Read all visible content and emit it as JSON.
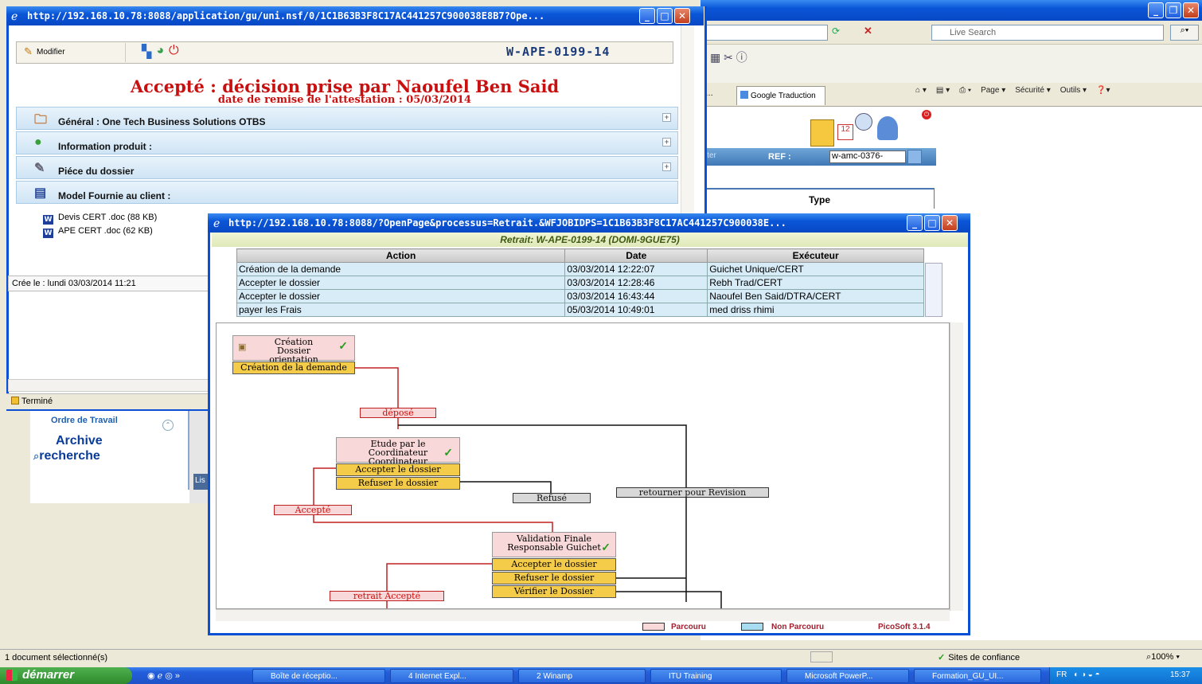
{
  "background_window": {
    "search_placeholder": "Live Search",
    "tab_google": "Google Traduction",
    "cmd_page": "Page ▾",
    "cmd_security": "Sécurité ▾",
    "cmd_tools": "Outils ▾",
    "ref_label": "REF :",
    "ref_value": "w-amc-0376-",
    "table_header_type": "Type",
    "ordre_de_travail": "Ordre de Travail",
    "archive": "Archive",
    "recherche": "recherche",
    "list_stub": "Lis",
    "iter_stub": "iter"
  },
  "doc_window": {
    "title": "http://192.168.10.78:8088/application/gu/uni.nsf/0/1C1B63B3F8C17AC441257C900038E8B7?Ope...",
    "modifier_label": "Modifier",
    "doc_number": "W-APE-0199-14",
    "status_title": "Accepté : décision prise par Naoufel Ben Said",
    "status_subtitle": "date de remise de l'attestation : 05/03/2014",
    "sections": [
      {
        "label": "Général : One Tech Business Solutions OTBS",
        "icon": "folder-gear-icon"
      },
      {
        "label": "Information produit :",
        "icon": "info-icon"
      },
      {
        "label": "Piéce du dossier",
        "icon": "paperclip-icon"
      },
      {
        "label": "Model Fournie au client :",
        "icon": "document-stack-icon"
      }
    ],
    "files": [
      {
        "name": "Devis CERT .doc (88 KB)"
      },
      {
        "name": "APE CERT .doc (62 KB)"
      }
    ],
    "created": "Crée le : lundi 03/03/2014 11:21",
    "status": "Terminé"
  },
  "workflow_window": {
    "title": "http://192.168.10.78:8088/?OpenPage&processus=Retrait.&WFJOBIDPS=1C1B63B3F8C17AC441257C900038E...",
    "header": "Retrait: W-APE-0199-14 (DOMI-9GUE75)",
    "columns": [
      "Action",
      "Date",
      "Exécuteur"
    ],
    "rows": [
      {
        "action": "Création de la demande",
        "date": "03/03/2014 12:22:07",
        "executor": "Guichet Unique/CERT"
      },
      {
        "action": "Accepter le dossier",
        "date": "03/03/2014 12:28:46",
        "executor": "Rebh Trad/CERT"
      },
      {
        "action": "Accepter le dossier",
        "date": "03/03/2014 16:43:44",
        "executor": "Naoufel Ben Said/DTRA/CERT"
      },
      {
        "action": "payer les Frais",
        "date": "05/03/2014 10:49:01",
        "executor": "med driss rhimi"
      }
    ],
    "diagram": {
      "node1_title": "Création Dossier orientation",
      "node1_btn": "Création de la demande",
      "label_depose": "déposé",
      "node2_title": "Etude par le Coordinateur Coordinateur",
      "node2_btn_accept": "Accepter le dossier",
      "node2_btn_refuse": "Refuser le dossier",
      "label_refuse": "Refusé",
      "label_revision": "retourner pour Revision",
      "label_accepte": "Accepté",
      "node3_title": "Validation Finale Responsable Guichet",
      "node3_btn_accept": "Accepter le dossier",
      "node3_btn_refuse": "Refuser le dossier",
      "node3_btn_verify": "Vérifier le Dossier",
      "label_retrait": "retrait Accepté"
    },
    "legend": {
      "parcouru": "Parcouru",
      "non_parcouru": "Non Parcouru",
      "version": "PicoSoft 3.1.4",
      "color_parcouru": "#f8d8d8",
      "color_non_parcouru": "#a8dcf0"
    }
  },
  "statusbar": {
    "selection": "1 document sélectionné(s)",
    "trust": "Sites de confiance",
    "zoom": "100%"
  },
  "taskbar": {
    "start": "démarrer",
    "tasks": [
      {
        "label": "Boîte de réceptio..."
      },
      {
        "label": "4 Internet Expl..."
      },
      {
        "label": "2 Winamp"
      },
      {
        "label": "ITU Training"
      },
      {
        "label": "Microsoft PowerP..."
      },
      {
        "label": "Formation_GU_UI..."
      }
    ],
    "lang": "FR",
    "clock": "15:37"
  },
  "colors": {
    "xp_blue": "#0a56d8",
    "status_red": "#c81010",
    "edge_red": "#c02020"
  }
}
